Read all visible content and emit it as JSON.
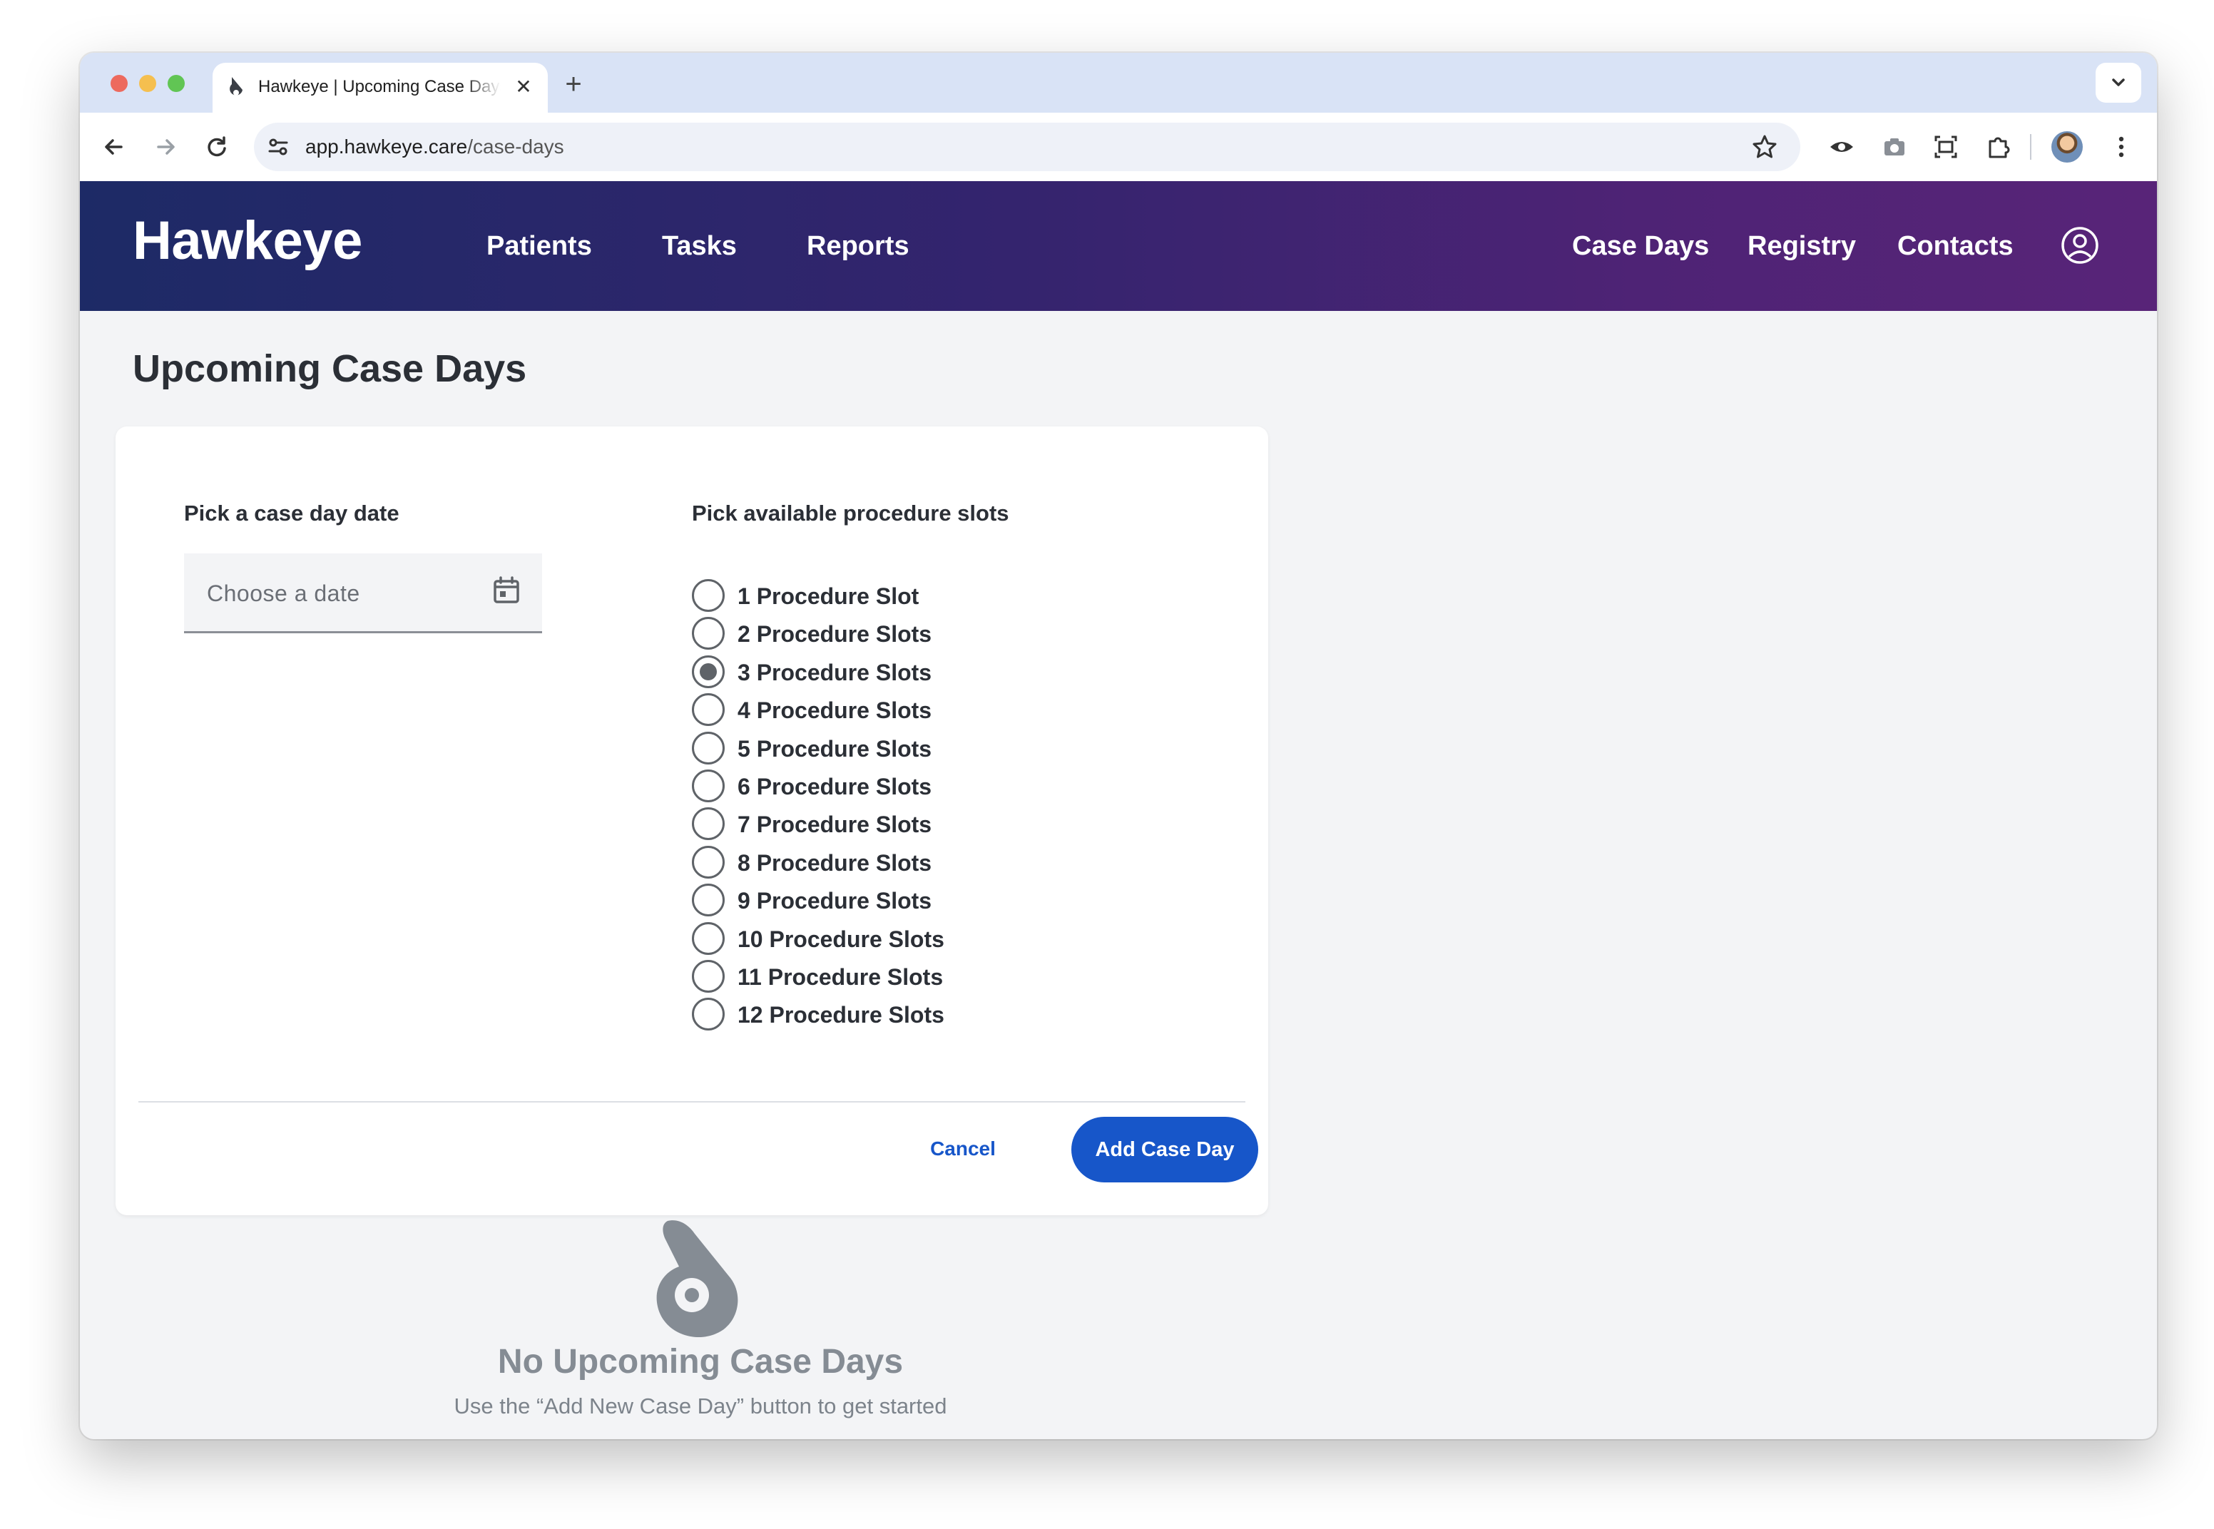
{
  "browser": {
    "tab_title": "Hawkeye | Upcoming Case Days",
    "url_host": "app.hawkeye.care",
    "url_path": "/case-days"
  },
  "app": {
    "brand": "Hawkeye",
    "nav_left": [
      "Patients",
      "Tasks",
      "Reports"
    ],
    "nav_right": [
      "Case Days",
      "Registry",
      "Contacts"
    ]
  },
  "page": {
    "title": "Upcoming Case Days"
  },
  "form": {
    "date_label": "Pick a case day date",
    "date_placeholder": "Choose a date",
    "slots_label": "Pick available procedure slots",
    "slot_options": [
      "1 Procedure Slot",
      "2 Procedure Slots",
      "3 Procedure Slots",
      "4 Procedure Slots",
      "5 Procedure Slots",
      "6 Procedure Slots",
      "7 Procedure Slots",
      "8 Procedure Slots",
      "9 Procedure Slots",
      "10 Procedure Slots",
      "11 Procedure Slots",
      "12 Procedure Slots"
    ],
    "selected_slot": "3 Procedure Slots",
    "cancel_label": "Cancel",
    "submit_label": "Add Case Day"
  },
  "empty_state": {
    "title": "No Upcoming Case Days",
    "subtitle": "Use the “Add New Case Day” button to get started"
  },
  "colors": {
    "primary": "#1756c9",
    "header_start": "#1d2a66",
    "header_end": "#582478",
    "empty_text": "#858c94"
  }
}
